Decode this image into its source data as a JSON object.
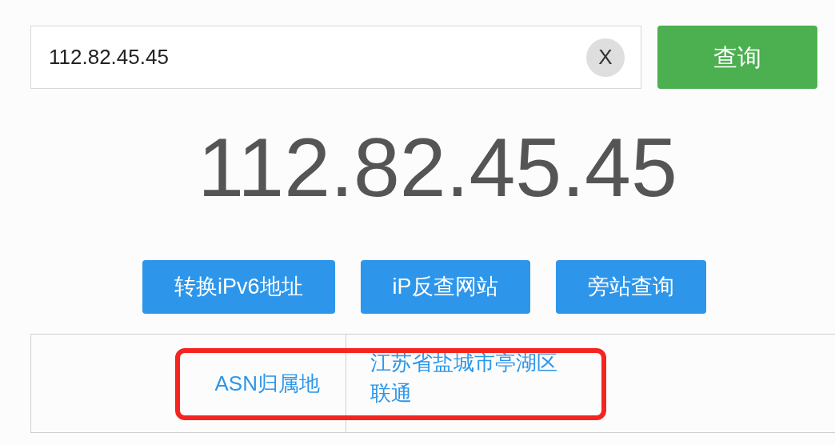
{
  "search": {
    "value": "112.82.45.45",
    "clear_label": "X",
    "submit_label": "查询"
  },
  "result_ip": "112.82.45.45",
  "actions": [
    "转换iPv6地址",
    "iP反查网站",
    "旁站查询"
  ],
  "table": {
    "rows": [
      {
        "label": "ASN归属地",
        "value_lines": [
          "江苏省盐城市亭湖区",
          "联通"
        ],
        "highlighted": true
      }
    ]
  }
}
